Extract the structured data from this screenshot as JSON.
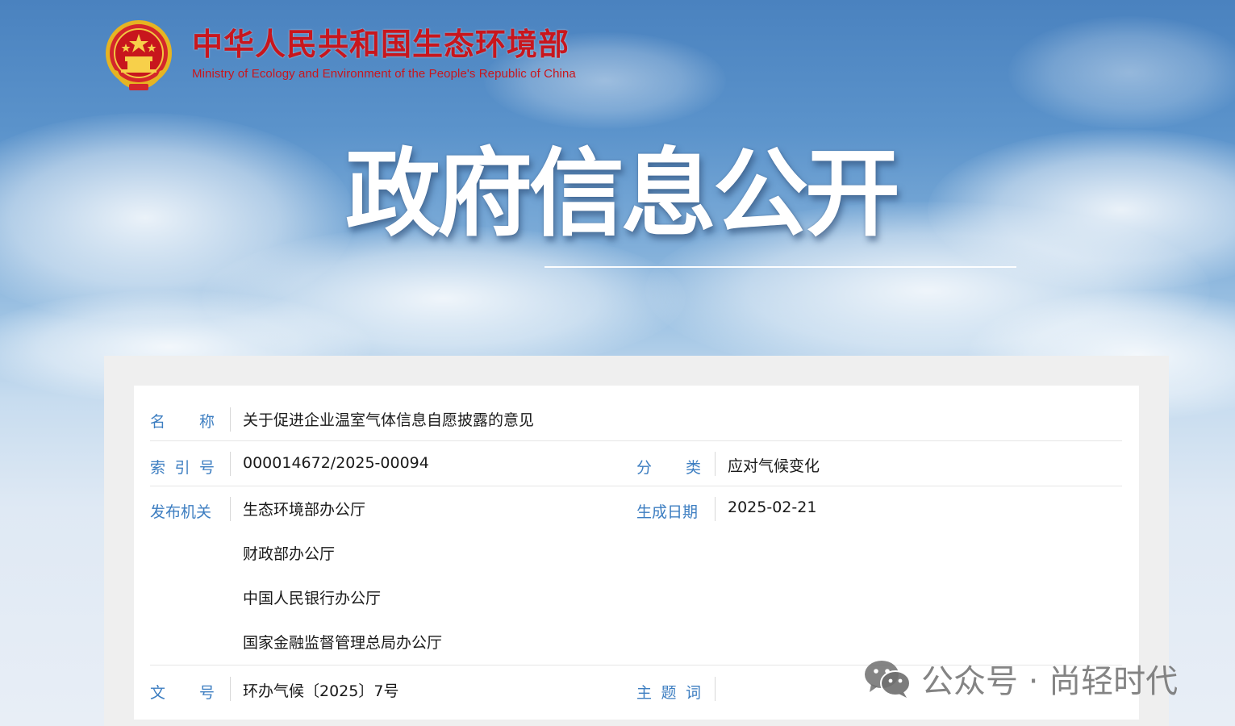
{
  "header": {
    "org_name_cn": "中华人民共和国生态环境部",
    "org_name_en": "Ministry of Ecology and Environment of the People's Republic of China",
    "emblem_icon": "national-emblem-icon"
  },
  "banner": {
    "title": "政府信息公开"
  },
  "info": {
    "name": {
      "label_chars": [
        "名",
        "称"
      ],
      "value": "关于促进企业温室气体信息自愿披露的意见"
    },
    "index_no": {
      "label_chars": [
        "索",
        "引",
        "号"
      ],
      "value": "000014672/2025-00094"
    },
    "category": {
      "label_chars": [
        "分",
        "类"
      ],
      "value": "应对气候变化"
    },
    "issuer": {
      "label": "发布机关",
      "values": [
        "生态环境部办公厅",
        "财政部办公厅",
        "中国人民银行办公厅",
        "国家金融监督管理总局办公厅"
      ]
    },
    "date": {
      "label": "生成日期",
      "value": "2025-02-21"
    },
    "doc_no": {
      "label_chars": [
        "文",
        "号"
      ],
      "value": "环办气候〔2025〕7号"
    },
    "keywords": {
      "label_chars": [
        "主",
        "题",
        "词"
      ],
      "value": ""
    }
  },
  "watermark": {
    "text": "公众号 · 尚轻时代",
    "icon": "wechat-icon"
  },
  "colors": {
    "brand_red": "#c8161d",
    "label_blue": "#3d7ec1",
    "value_text": "#1a1a1a"
  }
}
